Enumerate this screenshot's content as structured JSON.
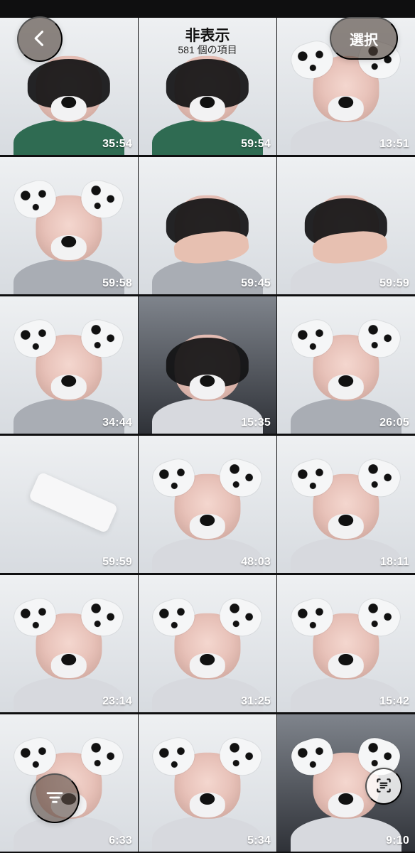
{
  "header": {
    "title": "非表示",
    "subtitle": "581 個の項目",
    "select_label": "選択"
  },
  "grid": {
    "tiles": [
      {
        "duration": "35:54"
      },
      {
        "duration": "59:54"
      },
      {
        "duration": "13:51"
      },
      {
        "duration": "59:58"
      },
      {
        "duration": "59:45"
      },
      {
        "duration": "59:59"
      },
      {
        "duration": "34:44"
      },
      {
        "duration": "15:35"
      },
      {
        "duration": "26:05"
      },
      {
        "duration": "59:59"
      },
      {
        "duration": "48:03"
      },
      {
        "duration": "18:11"
      },
      {
        "duration": "23:14"
      },
      {
        "duration": "31:25"
      },
      {
        "duration": "15:42"
      },
      {
        "duration": "6:33"
      },
      {
        "duration": "5:34"
      },
      {
        "duration": "9:10"
      }
    ]
  },
  "icons": {
    "back": "chevron-left-icon",
    "filter": "filter-icon",
    "scan": "scan-icon"
  },
  "colors": {
    "overlay_button": "#4e4038",
    "text_primary": "#111111",
    "duration_text": "#ffffff"
  }
}
